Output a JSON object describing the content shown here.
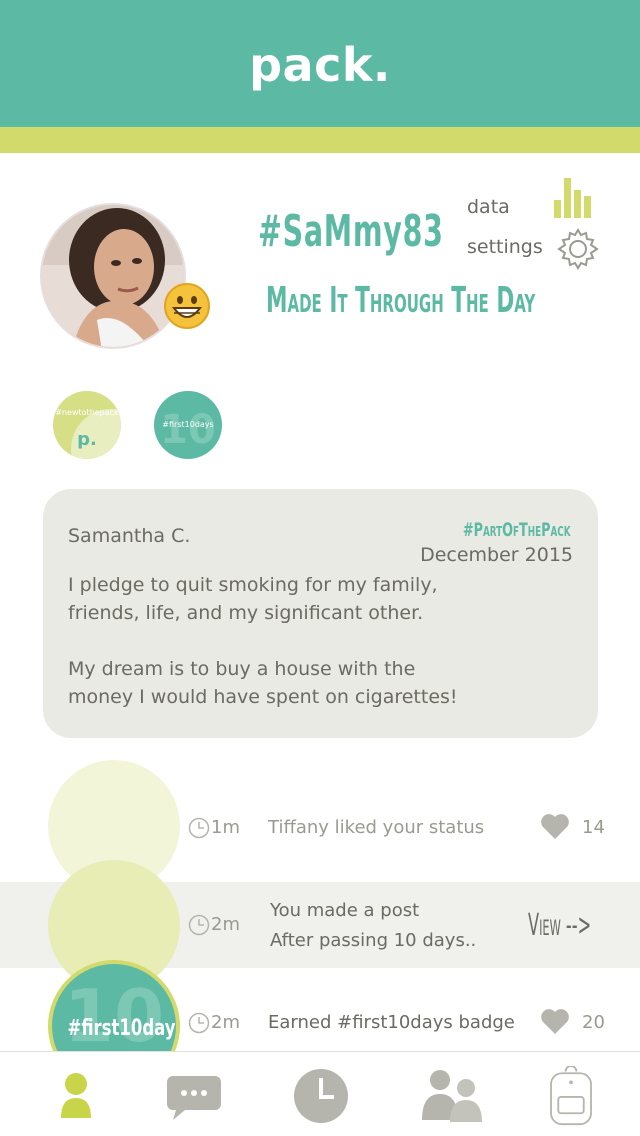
{
  "app": {
    "title": "pack."
  },
  "colors": {
    "primary": "#5cb9a3",
    "accent": "#d2da6c",
    "card": "#eaeae5",
    "text": "#6b6b62"
  },
  "profile": {
    "username": "#SaMmy83",
    "status": "Made It Through The Day",
    "avatar_icon": "profile-photo",
    "mood_icon": "grinning-emoji-icon"
  },
  "menu": {
    "data_label": "data",
    "settings_label": "settings"
  },
  "badges": [
    {
      "label": "#newtothepack",
      "icon": "pack-logo"
    },
    {
      "label": "#first10days",
      "icon": "ten-days"
    }
  ],
  "pledge": {
    "name": "Samantha C.",
    "tag": "#PartOfThePack",
    "date": "December 2015",
    "text": "I pledge to quit smoking for my family, friends, life, and my significant other.\n\nMy dream is to buy a house with the money I would have spent on cigarettes!"
  },
  "feed": [
    {
      "time": "1m",
      "text": "Tiffany liked your status",
      "likes": "14"
    },
    {
      "time": "2m",
      "text_line1": "You made a post",
      "text_line2": "After passing 10 days..",
      "action": "View -->"
    },
    {
      "time": "2m",
      "text": "Earned #first10days badge",
      "likes": "20",
      "badge_big": "10",
      "badge_text": "#first10days"
    }
  ],
  "tabs": [
    {
      "name": "profile",
      "icon": "person-icon",
      "active": true
    },
    {
      "name": "chat",
      "icon": "chat-bubble-icon"
    },
    {
      "name": "history",
      "icon": "clock-icon"
    },
    {
      "name": "community",
      "icon": "group-icon"
    },
    {
      "name": "pack",
      "icon": "backpack-icon"
    }
  ]
}
